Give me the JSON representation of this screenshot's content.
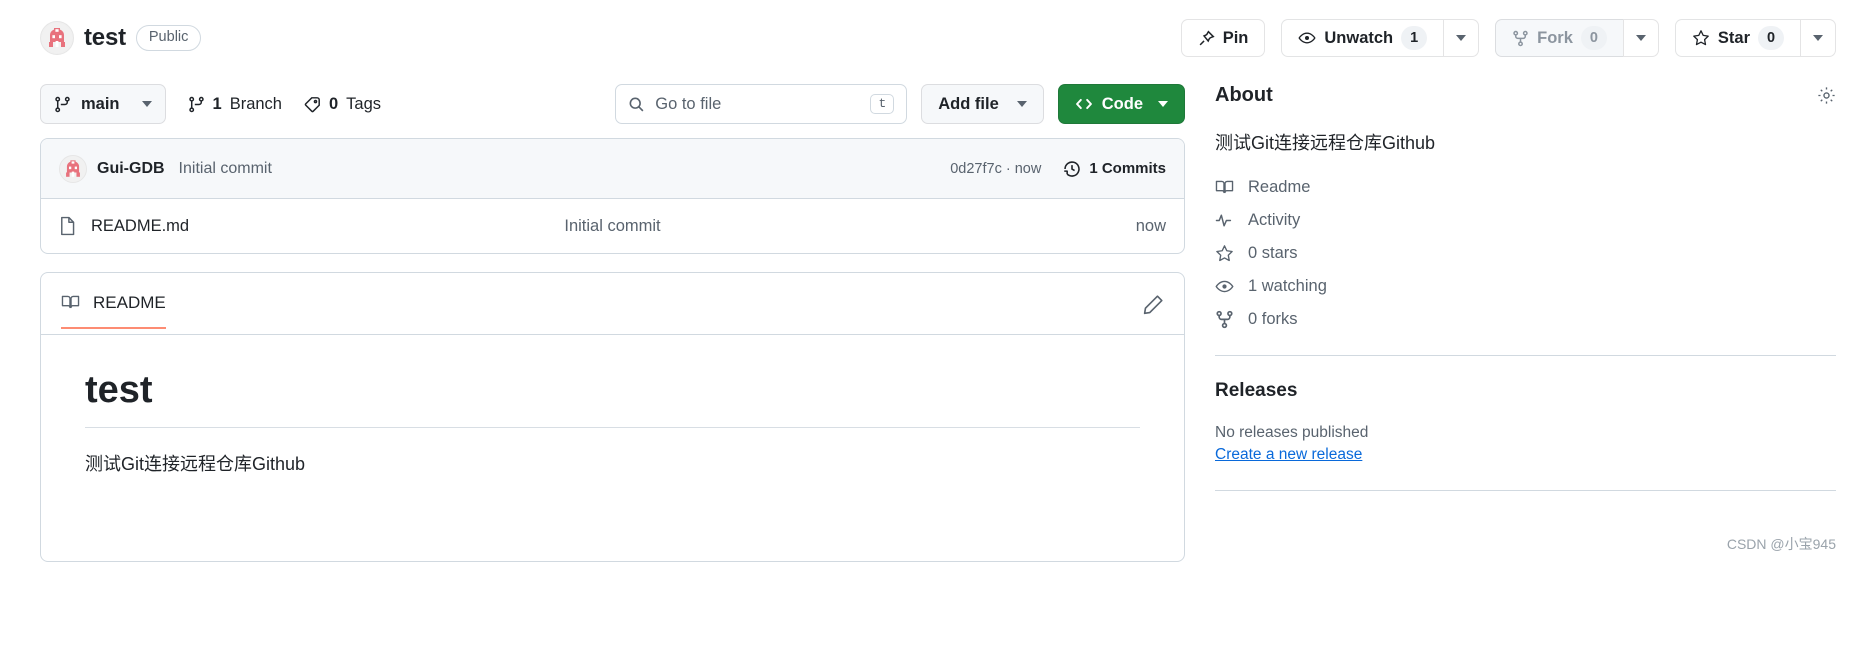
{
  "repo": {
    "name": "test",
    "visibility": "Public",
    "avatar_icon": "robot-avatar-icon"
  },
  "header_actions": {
    "pin_label": "Pin",
    "unwatch_label": "Unwatch",
    "unwatch_count": "1",
    "fork_label": "Fork",
    "fork_count": "0",
    "star_label": "Star",
    "star_count": "0"
  },
  "toolbar": {
    "branch": "main",
    "branch_count": "1",
    "branch_label": "Branch",
    "tag_count": "0",
    "tag_label": "Tags",
    "search_placeholder": "Go to file",
    "search_kbd": "t",
    "add_file_label": "Add file",
    "code_label": "Code"
  },
  "commit": {
    "author": "Gui-GDB",
    "message": "Initial commit",
    "sha": "0d27f7c · now",
    "count_label": "1 Commits"
  },
  "files": [
    {
      "name": "README.md",
      "icon": "file-icon",
      "commit_message": "Initial commit",
      "time": "now"
    }
  ],
  "readme": {
    "tab_label": "README",
    "edit_icon": "pencil-icon",
    "heading": "test",
    "paragraph": "测试Git连接远程仓库Github"
  },
  "about": {
    "title": "About",
    "settings_icon": "gear-icon",
    "description": "测试Git连接远程仓库Github",
    "links": [
      {
        "icon": "book-icon",
        "label": "Readme"
      },
      {
        "icon": "pulse-icon",
        "label": "Activity"
      },
      {
        "icon": "star-icon",
        "label": "0 stars"
      },
      {
        "icon": "eye-icon",
        "label": "1 watching"
      },
      {
        "icon": "fork-icon",
        "label": "0 forks"
      }
    ]
  },
  "releases": {
    "title": "Releases",
    "empty_text": "No releases published",
    "create_link": "Create a new release"
  },
  "watermark": "CSDN @小宝945",
  "colors": {
    "code_green": "#1f883d",
    "readme_underline": "#fd8c73",
    "link_blue": "#0969da",
    "muted": "#59636e",
    "border": "#d1d9e0"
  }
}
